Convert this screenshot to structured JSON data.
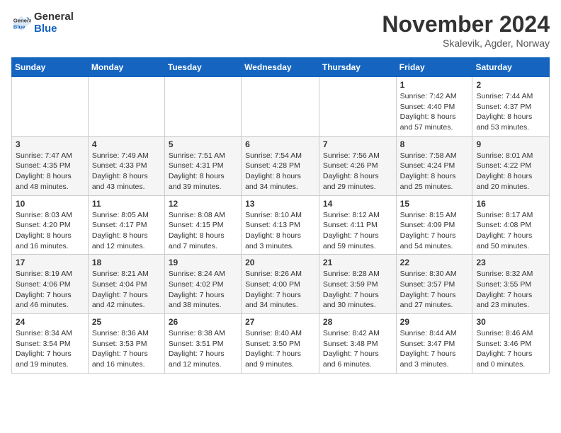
{
  "header": {
    "logo_line1": "General",
    "logo_line2": "Blue",
    "month": "November 2024",
    "location": "Skalevik, Agder, Norway"
  },
  "weekdays": [
    "Sunday",
    "Monday",
    "Tuesday",
    "Wednesday",
    "Thursday",
    "Friday",
    "Saturday"
  ],
  "rows": [
    [
      {
        "day": "",
        "info": ""
      },
      {
        "day": "",
        "info": ""
      },
      {
        "day": "",
        "info": ""
      },
      {
        "day": "",
        "info": ""
      },
      {
        "day": "",
        "info": ""
      },
      {
        "day": "1",
        "info": "Sunrise: 7:42 AM\nSunset: 4:40 PM\nDaylight: 8 hours\nand 57 minutes."
      },
      {
        "day": "2",
        "info": "Sunrise: 7:44 AM\nSunset: 4:37 PM\nDaylight: 8 hours\nand 53 minutes."
      }
    ],
    [
      {
        "day": "3",
        "info": "Sunrise: 7:47 AM\nSunset: 4:35 PM\nDaylight: 8 hours\nand 48 minutes."
      },
      {
        "day": "4",
        "info": "Sunrise: 7:49 AM\nSunset: 4:33 PM\nDaylight: 8 hours\nand 43 minutes."
      },
      {
        "day": "5",
        "info": "Sunrise: 7:51 AM\nSunset: 4:31 PM\nDaylight: 8 hours\nand 39 minutes."
      },
      {
        "day": "6",
        "info": "Sunrise: 7:54 AM\nSunset: 4:28 PM\nDaylight: 8 hours\nand 34 minutes."
      },
      {
        "day": "7",
        "info": "Sunrise: 7:56 AM\nSunset: 4:26 PM\nDaylight: 8 hours\nand 29 minutes."
      },
      {
        "day": "8",
        "info": "Sunrise: 7:58 AM\nSunset: 4:24 PM\nDaylight: 8 hours\nand 25 minutes."
      },
      {
        "day": "9",
        "info": "Sunrise: 8:01 AM\nSunset: 4:22 PM\nDaylight: 8 hours\nand 20 minutes."
      }
    ],
    [
      {
        "day": "10",
        "info": "Sunrise: 8:03 AM\nSunset: 4:20 PM\nDaylight: 8 hours\nand 16 minutes."
      },
      {
        "day": "11",
        "info": "Sunrise: 8:05 AM\nSunset: 4:17 PM\nDaylight: 8 hours\nand 12 minutes."
      },
      {
        "day": "12",
        "info": "Sunrise: 8:08 AM\nSunset: 4:15 PM\nDaylight: 8 hours\nand 7 minutes."
      },
      {
        "day": "13",
        "info": "Sunrise: 8:10 AM\nSunset: 4:13 PM\nDaylight: 8 hours\nand 3 minutes."
      },
      {
        "day": "14",
        "info": "Sunrise: 8:12 AM\nSunset: 4:11 PM\nDaylight: 7 hours\nand 59 minutes."
      },
      {
        "day": "15",
        "info": "Sunrise: 8:15 AM\nSunset: 4:09 PM\nDaylight: 7 hours\nand 54 minutes."
      },
      {
        "day": "16",
        "info": "Sunrise: 8:17 AM\nSunset: 4:08 PM\nDaylight: 7 hours\nand 50 minutes."
      }
    ],
    [
      {
        "day": "17",
        "info": "Sunrise: 8:19 AM\nSunset: 4:06 PM\nDaylight: 7 hours\nand 46 minutes."
      },
      {
        "day": "18",
        "info": "Sunrise: 8:21 AM\nSunset: 4:04 PM\nDaylight: 7 hours\nand 42 minutes."
      },
      {
        "day": "19",
        "info": "Sunrise: 8:24 AM\nSunset: 4:02 PM\nDaylight: 7 hours\nand 38 minutes."
      },
      {
        "day": "20",
        "info": "Sunrise: 8:26 AM\nSunset: 4:00 PM\nDaylight: 7 hours\nand 34 minutes."
      },
      {
        "day": "21",
        "info": "Sunrise: 8:28 AM\nSunset: 3:59 PM\nDaylight: 7 hours\nand 30 minutes."
      },
      {
        "day": "22",
        "info": "Sunrise: 8:30 AM\nSunset: 3:57 PM\nDaylight: 7 hours\nand 27 minutes."
      },
      {
        "day": "23",
        "info": "Sunrise: 8:32 AM\nSunset: 3:55 PM\nDaylight: 7 hours\nand 23 minutes."
      }
    ],
    [
      {
        "day": "24",
        "info": "Sunrise: 8:34 AM\nSunset: 3:54 PM\nDaylight: 7 hours\nand 19 minutes."
      },
      {
        "day": "25",
        "info": "Sunrise: 8:36 AM\nSunset: 3:53 PM\nDaylight: 7 hours\nand 16 minutes."
      },
      {
        "day": "26",
        "info": "Sunrise: 8:38 AM\nSunset: 3:51 PM\nDaylight: 7 hours\nand 12 minutes."
      },
      {
        "day": "27",
        "info": "Sunrise: 8:40 AM\nSunset: 3:50 PM\nDaylight: 7 hours\nand 9 minutes."
      },
      {
        "day": "28",
        "info": "Sunrise: 8:42 AM\nSunset: 3:48 PM\nDaylight: 7 hours\nand 6 minutes."
      },
      {
        "day": "29",
        "info": "Sunrise: 8:44 AM\nSunset: 3:47 PM\nDaylight: 7 hours\nand 3 minutes."
      },
      {
        "day": "30",
        "info": "Sunrise: 8:46 AM\nSunset: 3:46 PM\nDaylight: 7 hours\nand 0 minutes."
      }
    ]
  ]
}
